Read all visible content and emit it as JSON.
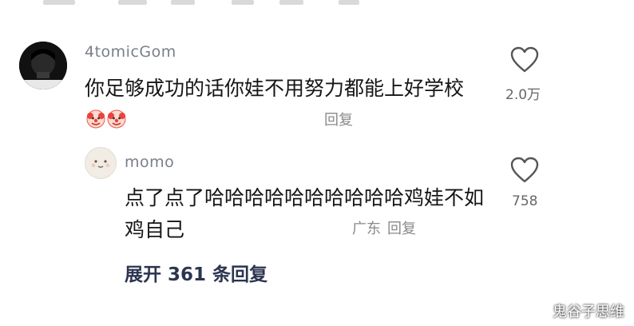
{
  "comment": {
    "username": "4tomicGom",
    "text": "你足够成功的话你娃不用努力都能上好学校",
    "emojis": [
      "clown-face-icon",
      "clown-face-icon"
    ],
    "reply_label": "回复",
    "like_count": "2.0万",
    "like_icon": "heart-outline-icon"
  },
  "reply": {
    "username": "momo",
    "text": "点了点了哈哈哈哈哈哈哈哈哈哈鸡娃不如鸡自己",
    "location": "广东",
    "reply_label": "回复",
    "like_count": "758",
    "like_icon": "heart-outline-icon"
  },
  "expand_label": "展开 361 条回复",
  "watermark": "鬼谷子思维"
}
